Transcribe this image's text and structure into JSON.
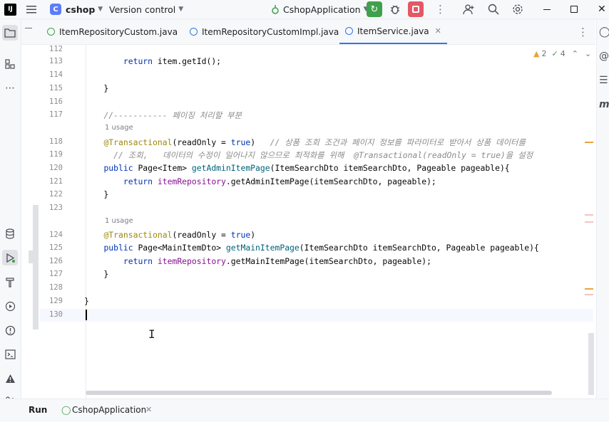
{
  "titlebar": {
    "project_badge": "C",
    "project_name": "cshop",
    "vcs_label": "Version control",
    "run_config": "CshopApplication"
  },
  "tabs": [
    {
      "label": "ItemRepositoryCustom.java",
      "color": "#3fa14b"
    },
    {
      "label": "ItemRepositoryCustomImpl.java",
      "color": "#3574f0"
    },
    {
      "label": "ItemService.java",
      "color": "#3574f0",
      "active": true
    }
  ],
  "inspections": {
    "warnings": "2",
    "checks": "4"
  },
  "editor": {
    "lines": [
      {
        "num": "112",
        "html": ""
      },
      {
        "num": "113",
        "html": "        return item.getId();"
      },
      {
        "num": "114",
        "html": ""
      },
      {
        "num": "115",
        "html": "    }"
      },
      {
        "num": "116",
        "html": ""
      },
      {
        "num": "117",
        "html": "    //----------- 페이징 처리할 부분"
      },
      {
        "num": "118",
        "html": "    @Transactional(readOnly = true)   // 상품 조회 조건과 페이지 정보를 파라미터로 받아서 상품 데이터를"
      },
      {
        "num": "119",
        "html": "      // 조회,   데이터의 수정이 일어나지 않으므로 최적화를 위해  @Transactional(readOnly = true)을 설정"
      },
      {
        "num": "120",
        "html": "    public Page<Item> getAdminItemPage(ItemSearchDto itemSearchDto, Pageable pageable){"
      },
      {
        "num": "121",
        "html": "        return itemRepository.getAdminItemPage(itemSearchDto, pageable);"
      },
      {
        "num": "122",
        "html": "    }"
      },
      {
        "num": "123",
        "html": ""
      },
      {
        "num": "124",
        "html": "    @Transactional(readOnly = true)"
      },
      {
        "num": "125",
        "html": "    public Page<MainItemDto> getMainItemPage(ItemSearchDto itemSearchDto, Pageable pageable){"
      },
      {
        "num": "126",
        "html": "        return itemRepository.getMainItemPage(itemSearchDto, pageable);"
      },
      {
        "num": "127",
        "html": "    }"
      },
      {
        "num": "128",
        "html": ""
      },
      {
        "num": "129",
        "html": "}"
      },
      {
        "num": "130",
        "html": ""
      }
    ],
    "usage_label": "1 usage"
  },
  "bottom": {
    "run_label": "Run",
    "run_tab": "CshopApplication"
  },
  "colors": {
    "accent": "#3574f0",
    "run_green": "#3fa14b",
    "stop_red": "#e55765"
  }
}
